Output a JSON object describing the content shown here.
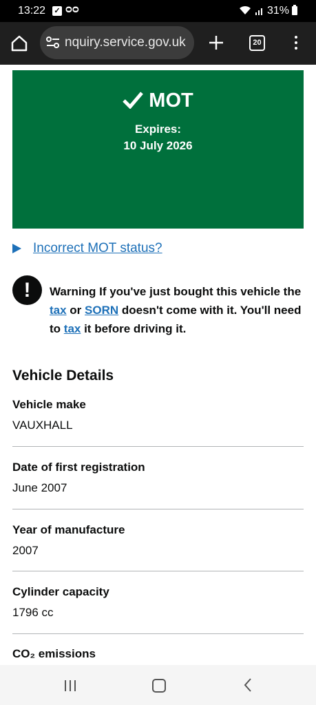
{
  "status_bar": {
    "time": "13:22",
    "battery": "31%",
    "icons": [
      "check-notification-icon",
      "voicemail-icon",
      "wifi-icon",
      "signal-icon",
      "battery-icon"
    ]
  },
  "browser": {
    "url": "nquiry.service.gov.uk",
    "tab_count": "20",
    "icons": [
      "home-icon",
      "site-settings-icon",
      "new-tab-icon",
      "tab-switcher-icon",
      "menu-icon"
    ]
  },
  "mot": {
    "title": "MOT",
    "expires_label": "Expires:",
    "expires_date": "10 July 2026",
    "status_color": "#00703c"
  },
  "details_link": "Incorrect MOT status?",
  "warning": {
    "prefix": "Warning",
    "line1_a": " If you've just bought this vehicle the ",
    "link_tax": "tax",
    "line1_b": " or ",
    "link_sorn": "SORN",
    "line1_c": " doesn't come with it. You'll need to ",
    "link_tax2": "tax",
    "line1_d": " it before driving it."
  },
  "vehicle_details": {
    "heading": "Vehicle Details",
    "rows": [
      {
        "label": "Vehicle make",
        "value": "VAUXHALL"
      },
      {
        "label": "Date of first registration",
        "value": "June 2007"
      },
      {
        "label": "Year of manufacture",
        "value": "2007"
      },
      {
        "label": "Cylinder capacity",
        "value": "1796 cc"
      },
      {
        "label": "CO₂ emissions",
        "value": ""
      }
    ]
  },
  "colors": {
    "link": "#1d70b8",
    "text": "#0b0c0c"
  }
}
